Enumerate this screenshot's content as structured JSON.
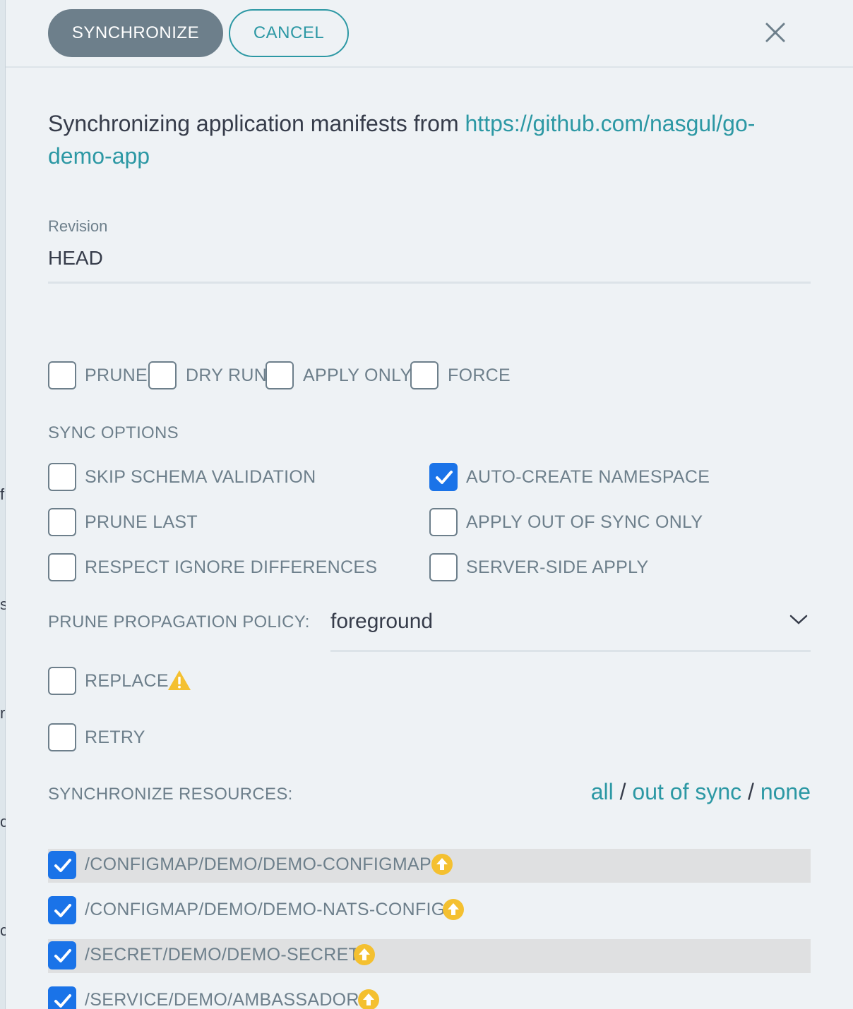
{
  "header": {
    "sync_button": "SYNCHRONIZE",
    "cancel_button": "CANCEL"
  },
  "intro": {
    "text": "Synchronizing application manifests from ",
    "repo_url": "https://github.com/nasgul/go-demo-app"
  },
  "revision": {
    "label": "Revision",
    "value": "HEAD"
  },
  "flags": [
    {
      "label": "PRUNE",
      "checked": false
    },
    {
      "label": "DRY RUN",
      "checked": false
    },
    {
      "label": "APPLY ONLY",
      "checked": false
    },
    {
      "label": "FORCE",
      "checked": false
    }
  ],
  "sync_options": {
    "title": "SYNC OPTIONS",
    "left": [
      {
        "label": "SKIP SCHEMA VALIDATION",
        "checked": false
      },
      {
        "label": "PRUNE LAST",
        "checked": false
      },
      {
        "label": "RESPECT IGNORE DIFFERENCES",
        "checked": false
      }
    ],
    "right": [
      {
        "label": "AUTO-CREATE NAMESPACE",
        "checked": true
      },
      {
        "label": "APPLY OUT OF SYNC ONLY",
        "checked": false
      },
      {
        "label": "SERVER-SIDE APPLY",
        "checked": false
      }
    ]
  },
  "prune_policy": {
    "label": "PRUNE PROPAGATION POLICY:",
    "value": "foreground"
  },
  "replace": {
    "label": "REPLACE",
    "checked": false,
    "icon": "warning-icon",
    "icon_color": "#f4c030"
  },
  "retry": {
    "label": "RETRY",
    "checked": false
  },
  "resources": {
    "title": "SYNCHRONIZE RESOURCES:",
    "filter_all": "all",
    "filter_out_of_sync": "out of sync",
    "filter_none": "none",
    "separator": "/",
    "items": [
      {
        "label": "/CONFIGMAP/DEMO/DEMO-CONFIGMAP",
        "checked": true,
        "status_icon": "out-of-sync-arrow-icon"
      },
      {
        "label": "/CONFIGMAP/DEMO/DEMO-NATS-CONFIG",
        "checked": true,
        "status_icon": "out-of-sync-arrow-icon"
      },
      {
        "label": "/SECRET/DEMO/DEMO-SECRET",
        "checked": true,
        "status_icon": "out-of-sync-arrow-icon"
      },
      {
        "label": "/SERVICE/DEMO/AMBASSADOR",
        "checked": true,
        "status_icon": "out-of-sync-arrow-icon"
      }
    ]
  },
  "colors": {
    "accent": "#2c98a4",
    "primary_button": "#6d7f8b",
    "checkbox_checked": "#1a73e8",
    "status_yellow": "#f4c030"
  }
}
